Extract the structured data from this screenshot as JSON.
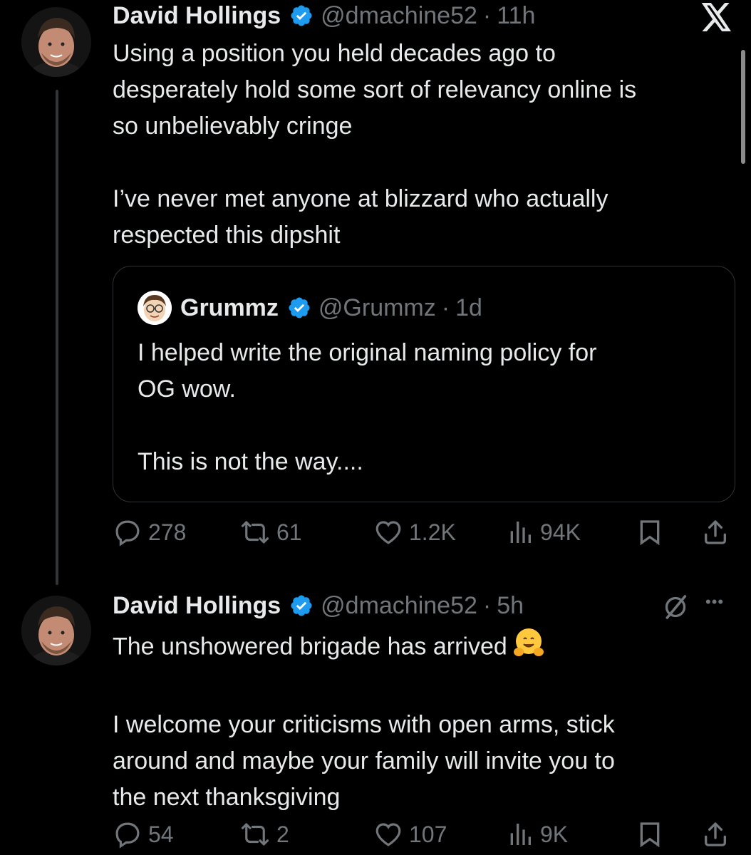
{
  "tweets": [
    {
      "name": "David Hollings",
      "handle": "@dmachine52",
      "dot": "·",
      "time": "11h",
      "lines": [
        "Using a position you held decades ago to",
        "desperately hold some sort of relevancy online is",
        "so unbelievably cringe",
        "I’ve never met anyone at blizzard who actually",
        "respected this dipshit"
      ],
      "quote": {
        "name": "Grummz",
        "handle": "@Grummz",
        "dot": "·",
        "time": "1d",
        "lines": [
          "I helped write the original naming policy for",
          "OG wow.",
          "This is not the way...."
        ]
      },
      "stats": {
        "replies": "278",
        "reposts": "61",
        "likes": "1.2K",
        "views": "94K"
      }
    },
    {
      "name": "David Hollings",
      "handle": "@dmachine52",
      "dot": "·",
      "time": "5h",
      "lines": [
        "The unshowered brigade has arrived",
        "I welcome your criticisms with open arms, stick",
        "around and maybe your family will invite you to",
        "the next thanksgiving"
      ],
      "emoji": "hugging-face",
      "stats": {
        "replies": "54",
        "reposts": "2",
        "likes": "107",
        "views": "9K"
      }
    }
  ],
  "icons": {
    "verified_color": "#1d9bf0",
    "brand": "x-logo",
    "more": "•••"
  }
}
